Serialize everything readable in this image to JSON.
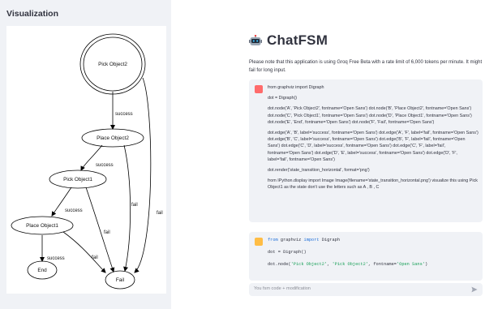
{
  "sidebar": {
    "title": "Visualization",
    "graph": {
      "nodes": {
        "A": "Pick Object2",
        "B": "Place Object2",
        "C": "Pick Object1",
        "D": "Place Object1",
        "E": "End",
        "F": "Fail"
      },
      "edge_labels": {
        "AB": "success",
        "AF": "fail",
        "BC": "success",
        "BF": "fail",
        "CD": "success",
        "CF": "fail",
        "DE": "success",
        "DF": "fail"
      }
    }
  },
  "header": {
    "icon": "robot-icon",
    "title": "ChatFSM"
  },
  "notice": "Please note that this application is using Groq Free Beta with a rate limit of 6,000 tokens per minute. It might fail for long input.",
  "user_message": {
    "paragraphs": [
      "from graphviz import Digraph",
      "dot = Digraph()",
      "dot.node('A', 'Pick Object2', fontname='Open Sans') dot.node('B', 'Place Object2', fontname='Open Sans') dot.node('C', 'Pick Object1', fontname='Open Sans') dot.node('D', 'Place Object1', fontname='Open Sans') dot.node('E', 'End', fontname='Open Sans') dot.node('F', 'Fail', fontname='Open Sans')",
      "dot.edge('A', 'B', label='success', fontname='Open Sans') dot.edge('A', 'F', label='fail', fontname='Open Sans') dot.edge('B', 'C', label='success', fontname='Open Sans') dot.edge('B', 'F', label='fail', fontname='Open Sans') dot.edge('C', 'D', label='success', fontname='Open Sans') dot.edge('C', 'F', label='fail', fontname='Open Sans') dot.edge('D', 'E', label='success', fontname='Open Sans') dot.edge('D', 'F', label='fail', fontname='Open Sans')",
      "dot.render('state_transition_horizontal', format='png')",
      "from IPython.display import Image Image(filename='state_transition_horizontal.png') visualize this using Pick Object1 as the state don't use the letters such as A , B , C"
    ]
  },
  "bot_message": {
    "code_lines": [
      {
        "kw": "from",
        "a": " graphviz ",
        "kw2": "import",
        "b": " Digraph"
      },
      {
        "plain": "dot = Digraph()"
      },
      {
        "pre": "dot.node(",
        "s1": "'Pick Object2'",
        "mid": ", ",
        "s2": "'Pick Object2'",
        "mid2": ", fontname=",
        "s3": "'Open Sans'",
        "post": ")"
      }
    ]
  },
  "input": {
    "placeholder": "You fsm code + modification"
  },
  "colors": {
    "sidebar_bg": "#f0f2f6",
    "user_avatar": "#ff6b6b",
    "bot_avatar": "#ffbd45",
    "keyword": "#1e6fd9",
    "string": "#18a058"
  }
}
